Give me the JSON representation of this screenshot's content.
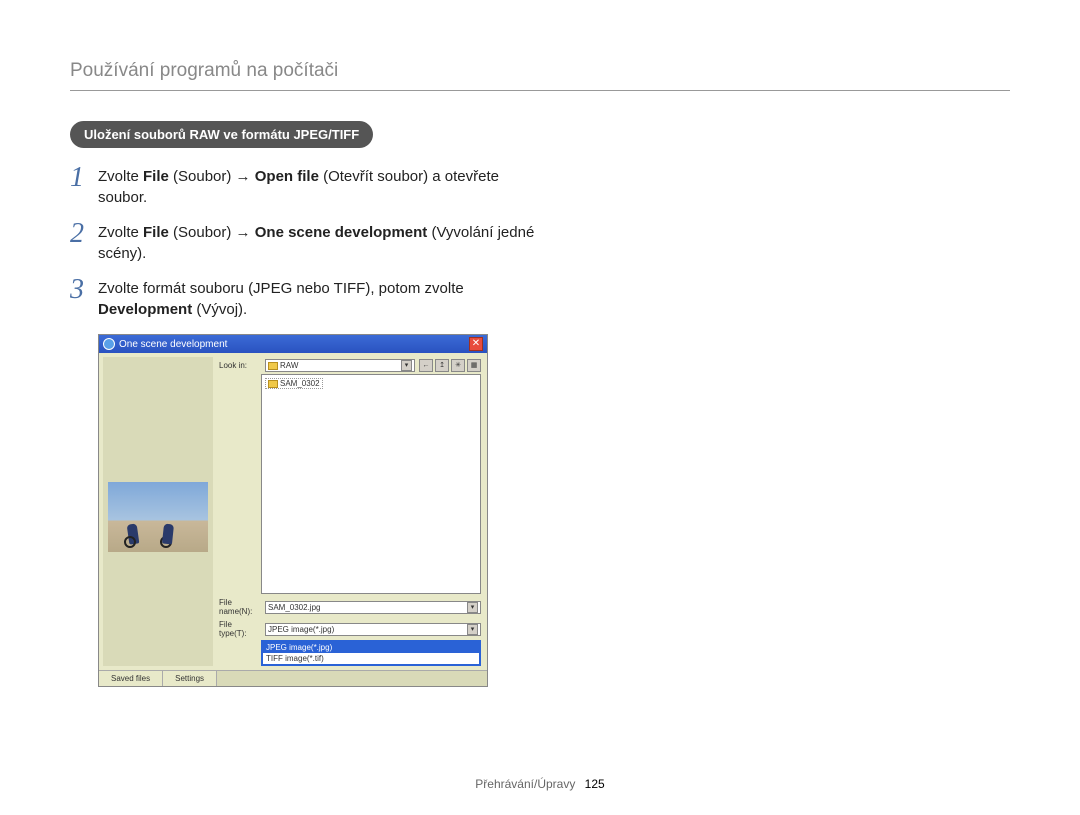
{
  "pageTitle": "Používání programů na počítači",
  "pill": "Uložení souborů RAW ve formátu JPEG/TIFF",
  "steps": {
    "s1": {
      "num": "1",
      "p1_a": "Zvolte ",
      "p1_b": "File",
      "p1_c": " (Soubor) → ",
      "p1_d": "Open file",
      "p1_e": " (Otevřít soubor) a otevřete soubor."
    },
    "s2": {
      "num": "2",
      "p2_a": "Zvolte ",
      "p2_b": "File",
      "p2_c": " (Soubor) → ",
      "p2_d": "One scene development",
      "p2_e": " (Vyvolání jedné scény)."
    },
    "s3": {
      "num": "3",
      "p3_a": "Zvolte formát souboru (JPEG nebo TIFF), potom zvolte ",
      "p3_b": "Development",
      "p3_c": " (Vývoj)."
    }
  },
  "dialog": {
    "title": "One scene development",
    "lookin_label": "Look in:",
    "lookin_value": "RAW",
    "nav_back": "←",
    "nav_up": "↥",
    "nav_new": "✳",
    "nav_view": "▦",
    "file_item": "SAM_0302",
    "filename_label": "File name(N):",
    "filename_value": "SAM_0302.jpg",
    "filetype_label": "File type(T):",
    "filetype_value": "JPEG image(*.jpg)",
    "filetype_opt1": "JPEG image(*.jpg)",
    "filetype_opt2": "TIFF image(*.tif)",
    "tab_saved": "Saved files",
    "tab_settings": "Settings"
  },
  "footer": {
    "section": "Přehrávání/Úpravy",
    "page": "125"
  }
}
